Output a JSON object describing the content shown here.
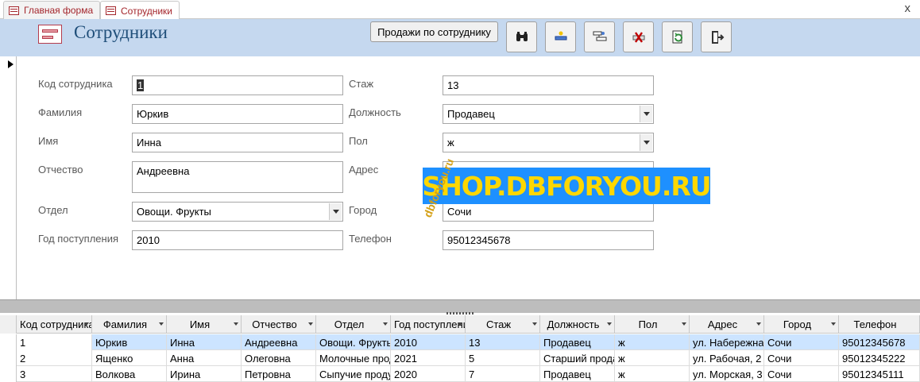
{
  "tabs": [
    {
      "label": "Главная форма",
      "active": false
    },
    {
      "label": "Сотрудники",
      "active": true
    }
  ],
  "close_label": "x",
  "header": {
    "title": "Сотрудники",
    "sales_button": "Продажи по сотруднику",
    "tools": [
      "binoculars-icon",
      "new-record-icon",
      "save-record-icon",
      "delete-record-icon",
      "refresh-icon",
      "exit-icon"
    ]
  },
  "form": {
    "labels": {
      "id": "Код сотрудника",
      "surname": "Фамилия",
      "name": "Имя",
      "patronymic": "Отчество",
      "dept": "Отдел",
      "year": "Год поступления",
      "experience": "Стаж",
      "position": "Должность",
      "gender": "Пол",
      "address": "Адрес",
      "city": "Город",
      "phone": "Телефон"
    },
    "values": {
      "id": "1",
      "surname": "Юркив",
      "name": "Инна",
      "patronymic": "Андреевна",
      "dept": "Овощи. Фрукты",
      "year": "2010",
      "experience": "13",
      "position": "Продавец",
      "gender": "ж",
      "address": "",
      "city": "Сочи",
      "phone": "95012345678"
    }
  },
  "watermark": {
    "text": "SHOP.DBFORYOU.RU",
    "diagonal": "dbforyou.ru",
    "bg": "#1e90ff",
    "fg": "#ffd700"
  },
  "grid": {
    "columns": [
      "Код сотрудника",
      "Фамилия",
      "Имя",
      "Отчество",
      "Отдел",
      "Год поступления",
      "Стаж",
      "Должность",
      "Пол",
      "Адрес",
      "Город",
      "Телефон"
    ],
    "rows": [
      [
        "1",
        "Юркив",
        "Инна",
        "Андреевна",
        "Овощи. Фрукты",
        "2010",
        "13",
        "Продавец",
        "ж",
        "ул. Набережная",
        "Сочи",
        "95012345678"
      ],
      [
        "2",
        "Ященко",
        "Анна",
        "Олеговна",
        "Молочные продукты",
        "2021",
        "5",
        "Старший продавец",
        "ж",
        "ул. Рабочая, 2",
        "Сочи",
        "95012345222"
      ],
      [
        "3",
        "Волкова",
        "Ирина",
        "Петровна",
        "Сыпучие продукты",
        "2020",
        "7",
        "Продавец",
        "ж",
        "ул. Морская, 3",
        "Сочи",
        "95012345111"
      ]
    ],
    "selected_row": 0
  }
}
